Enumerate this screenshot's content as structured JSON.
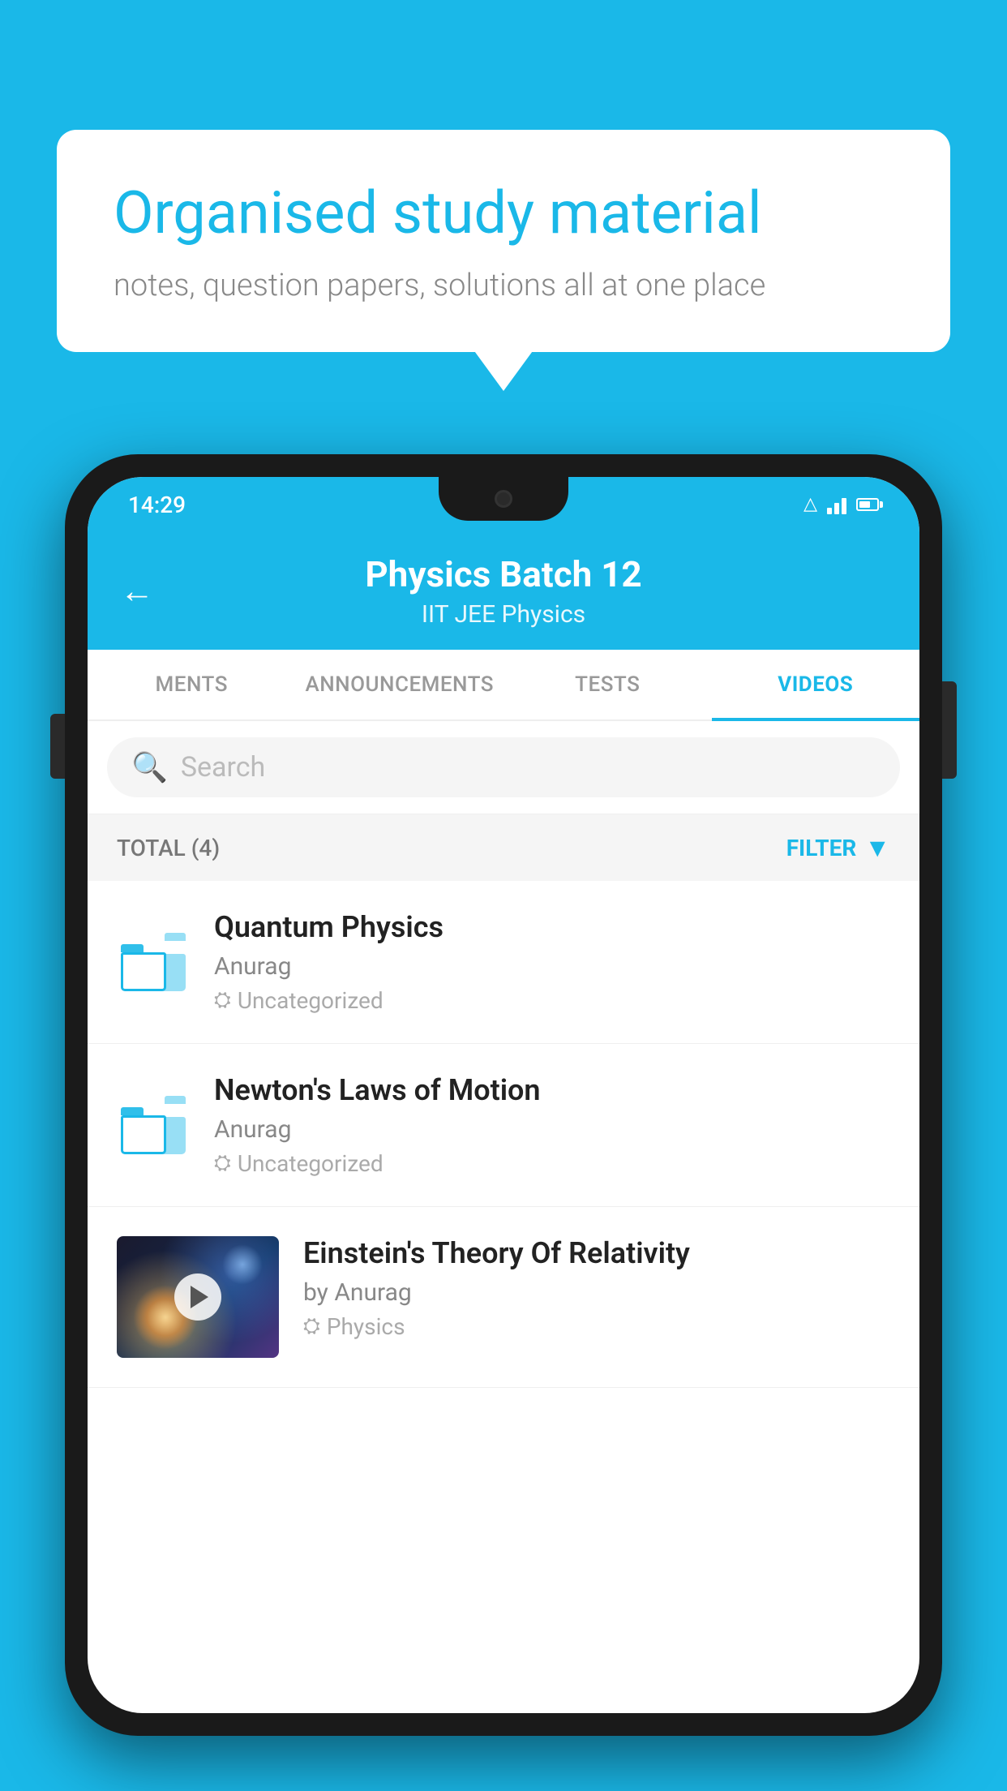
{
  "background_color": "#1ab8e8",
  "hero": {
    "bubble_title": "Organised study material",
    "bubble_subtitle": "notes, question papers, solutions all at one place"
  },
  "phone": {
    "status_bar": {
      "time": "14:29"
    },
    "header": {
      "title": "Physics Batch 12",
      "subtitle": "IIT JEE   Physics",
      "back_label": "←"
    },
    "tabs": [
      {
        "label": "MENTS",
        "active": false
      },
      {
        "label": "ANNOUNCEMENTS",
        "active": false
      },
      {
        "label": "TESTS",
        "active": false
      },
      {
        "label": "VIDEOS",
        "active": true
      }
    ],
    "search": {
      "placeholder": "Search"
    },
    "filter_bar": {
      "total_label": "TOTAL (4)",
      "filter_label": "FILTER"
    },
    "videos": [
      {
        "id": 1,
        "title": "Quantum Physics",
        "author": "Anurag",
        "tag": "Uncategorized",
        "has_thumb": false
      },
      {
        "id": 2,
        "title": "Newton's Laws of Motion",
        "author": "Anurag",
        "tag": "Uncategorized",
        "has_thumb": false
      },
      {
        "id": 3,
        "title": "Einstein's Theory Of Relativity",
        "author": "by Anurag",
        "tag": "Physics",
        "has_thumb": true
      }
    ]
  }
}
